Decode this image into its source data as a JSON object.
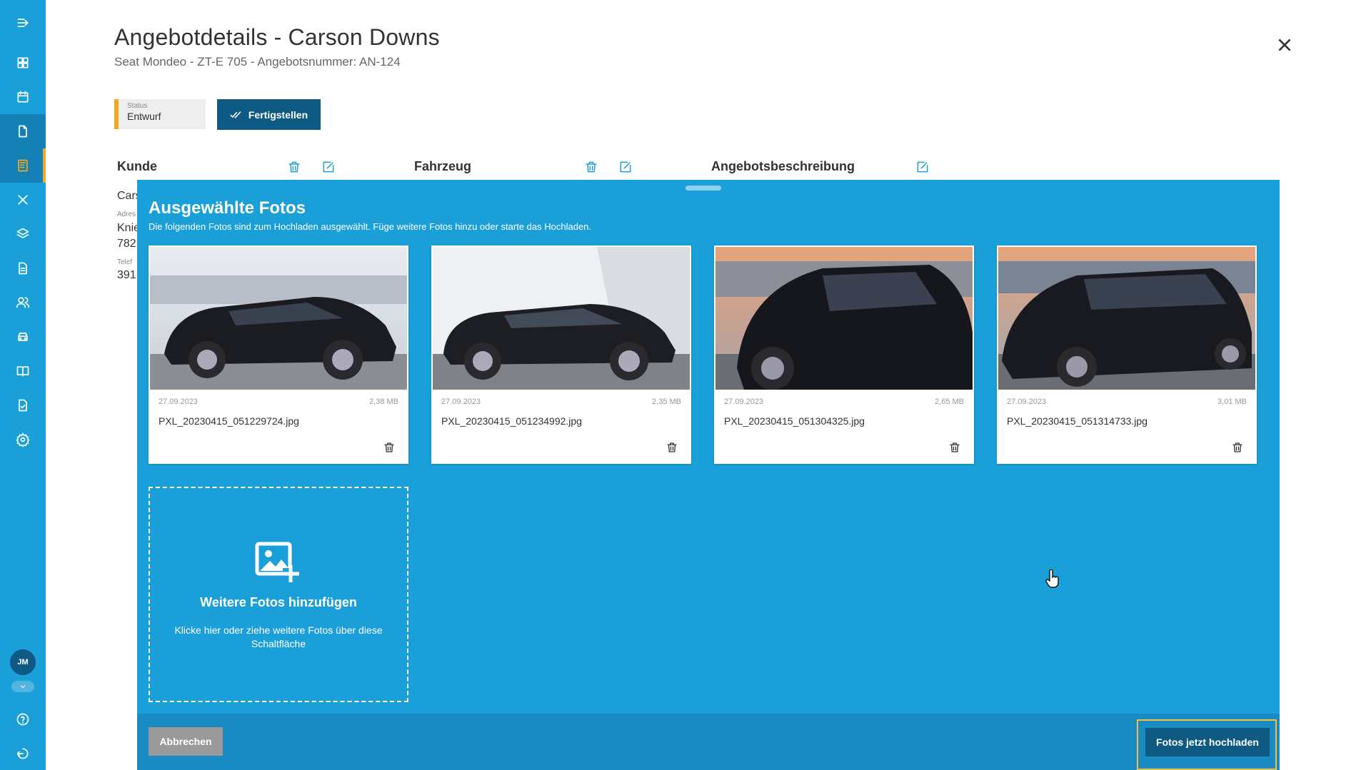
{
  "header": {
    "title": "Angebotdetails - Carson Downs",
    "subtitle": "Seat Mondeo - ZT-E 705 - Angebotsnummer: AN-124"
  },
  "status": {
    "label": "Status",
    "value": "Entwurf",
    "accent": "#f5a623"
  },
  "finish_label": "Fertigstellen",
  "sections": {
    "customer": "Kunde",
    "vehicle": "Fahrzeug",
    "offer_description": "Angebotsbeschreibung"
  },
  "background_customer": {
    "name": "Cars",
    "address_label": "Adres",
    "address_line1": "Knie",
    "address_line2": "782",
    "phone_label": "Telef",
    "phone": "391"
  },
  "sidebar": {
    "items": [
      "menu-toggle",
      "dashboard",
      "calendar",
      "documents",
      "offers",
      "tools",
      "layers",
      "reports",
      "customers",
      "vehicles",
      "catalog",
      "invoices",
      "settings"
    ],
    "user_initials": "JM",
    "bottom": [
      "help",
      "logout"
    ]
  },
  "overlay": {
    "title": "Ausgewählte Fotos",
    "description": "Die folgenden Fotos sind zum Hochladen ausgewählt. Füge weitere Fotos hinzu oder starte das Hochladen.",
    "photos": [
      {
        "date": "27.09.2023",
        "size": "2,38 MB",
        "name": "PXL_20230415_051229724.jpg"
      },
      {
        "date": "27.09.2023",
        "size": "2,35 MB",
        "name": "PXL_20230415_051234992.jpg"
      },
      {
        "date": "27.09.2023",
        "size": "2,65 MB",
        "name": "PXL_20230415_051304325.jpg"
      },
      {
        "date": "27.09.2023",
        "size": "3,01 MB",
        "name": "PXL_20230415_051314733.jpg"
      }
    ],
    "add_more": {
      "title": "Weitere Fotos hinzufügen",
      "description": "Klicke hier oder ziehe weitere Fotos über diese Schaltfläche"
    },
    "cancel_label": "Abbrechen",
    "upload_label": "Fotos jetzt hochladen"
  },
  "colors": {
    "primary": "#1b9fd8",
    "dark_primary": "#0e5a82",
    "footer": "#1a8ac2",
    "draft": "#f5a623"
  }
}
